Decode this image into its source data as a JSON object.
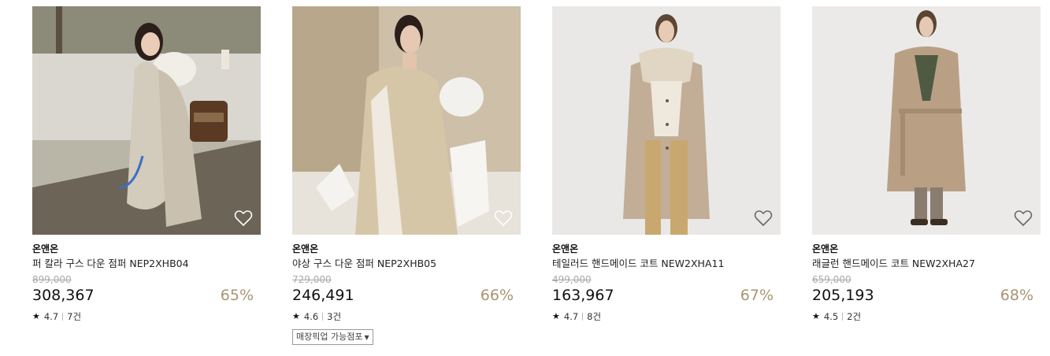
{
  "products": [
    {
      "brand": "온앤온",
      "name": "퍼 칼라 구스 다운 점퍼 NEP2XHB04",
      "original_price": "899,000",
      "price": "308,367",
      "discount": "65%",
      "rating": "4.7",
      "reviews": "7건"
    },
    {
      "brand": "온앤온",
      "name": "야상 구스 다운 점퍼 NEP2XHB05",
      "original_price": "729,000",
      "price": "246,491",
      "discount": "66%",
      "rating": "4.6",
      "reviews": "3건",
      "pickup_label": "매장픽업 가능점포"
    },
    {
      "brand": "온앤온",
      "name": "테일러드 핸드메이드 코트 NEW2XHA11",
      "original_price": "499,000",
      "price": "163,967",
      "discount": "67%",
      "rating": "4.7",
      "reviews": "8건"
    },
    {
      "brand": "온앤온",
      "name": "래글런 핸드메이드 코트 NEW2XHA27",
      "original_price": "659,000",
      "price": "205,193",
      "discount": "68%",
      "rating": "4.5",
      "reviews": "2건"
    }
  ],
  "icons": {
    "wishlist": "heart-outline-icon",
    "rating": "star-icon",
    "dropdown": "caret-down-icon"
  },
  "colors": {
    "discount": "#a89572",
    "original_price": "#aaaaaa"
  }
}
